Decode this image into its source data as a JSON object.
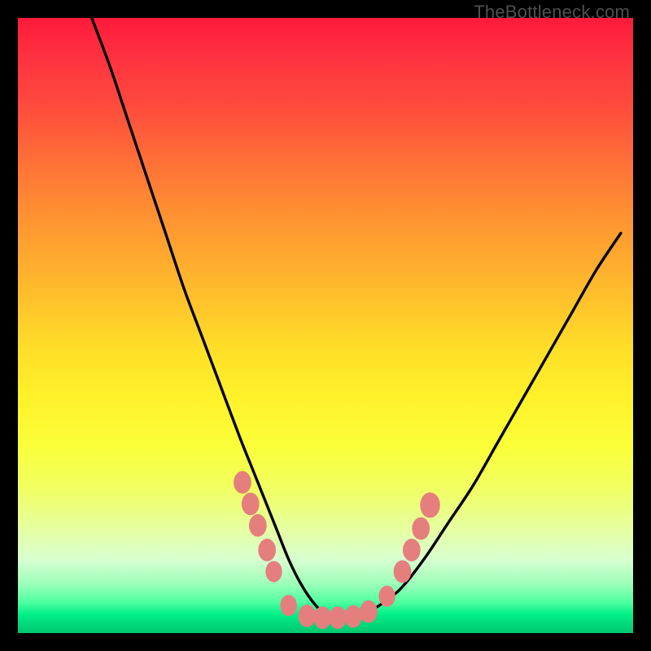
{
  "watermark": "TheBottleneck.com",
  "colors": {
    "frame": "#000000",
    "gradient_top": "#ff1a3a",
    "gradient_mid": "#ffdf28",
    "gradient_bottom": "#00c76f",
    "curve": "#000000",
    "bead": "#e57f7d"
  },
  "chart_data": {
    "type": "line",
    "title": "",
    "xlabel": "",
    "ylabel": "",
    "xlim": [
      0,
      100
    ],
    "ylim": [
      0,
      100
    ],
    "note": "Bottleneck-style V-curve on a vertical heat gradient. Axes are unlabeled; values are estimated from pixel positions as percentages of the plot area (x left→right, y bottom→top).",
    "series": [
      {
        "name": "v-curve",
        "x": [
          12,
          15,
          18,
          21,
          24,
          27,
          30,
          33,
          36,
          38,
          40,
          42,
          44,
          46,
          48,
          50,
          52,
          54,
          56,
          58,
          62,
          66,
          70,
          74,
          78,
          82,
          86,
          90,
          94,
          98
        ],
        "y": [
          100,
          92,
          83,
          74,
          65,
          56,
          48,
          40,
          32,
          27,
          22,
          17,
          12,
          8,
          5,
          3,
          2.5,
          2.5,
          3,
          4,
          7,
          12,
          18,
          24,
          31,
          38,
          45,
          52,
          59,
          65
        ]
      }
    ],
    "markers": {
      "name": "beads",
      "comment": "Pink blobs clustered near the curve minimum; coordinates are percentages of plot area.",
      "points": [
        {
          "x": 36.5,
          "y": 24.5,
          "r": 1.6
        },
        {
          "x": 37.8,
          "y": 21.0,
          "r": 1.6
        },
        {
          "x": 39.0,
          "y": 17.5,
          "r": 1.6
        },
        {
          "x": 40.5,
          "y": 13.5,
          "r": 1.6
        },
        {
          "x": 41.6,
          "y": 10.0,
          "r": 1.5
        },
        {
          "x": 44.0,
          "y": 4.5,
          "r": 1.5
        },
        {
          "x": 47.0,
          "y": 2.8,
          "r": 1.6
        },
        {
          "x": 49.5,
          "y": 2.5,
          "r": 1.6
        },
        {
          "x": 52.0,
          "y": 2.5,
          "r": 1.6
        },
        {
          "x": 54.5,
          "y": 2.7,
          "r": 1.6
        },
        {
          "x": 57.0,
          "y": 3.5,
          "r": 1.6
        },
        {
          "x": 60.0,
          "y": 6.0,
          "r": 1.5
        },
        {
          "x": 62.5,
          "y": 10.0,
          "r": 1.6
        },
        {
          "x": 64.0,
          "y": 13.5,
          "r": 1.6
        },
        {
          "x": 65.5,
          "y": 17.0,
          "r": 1.6
        },
        {
          "x": 67.0,
          "y": 20.8,
          "r": 1.8
        }
      ]
    }
  }
}
